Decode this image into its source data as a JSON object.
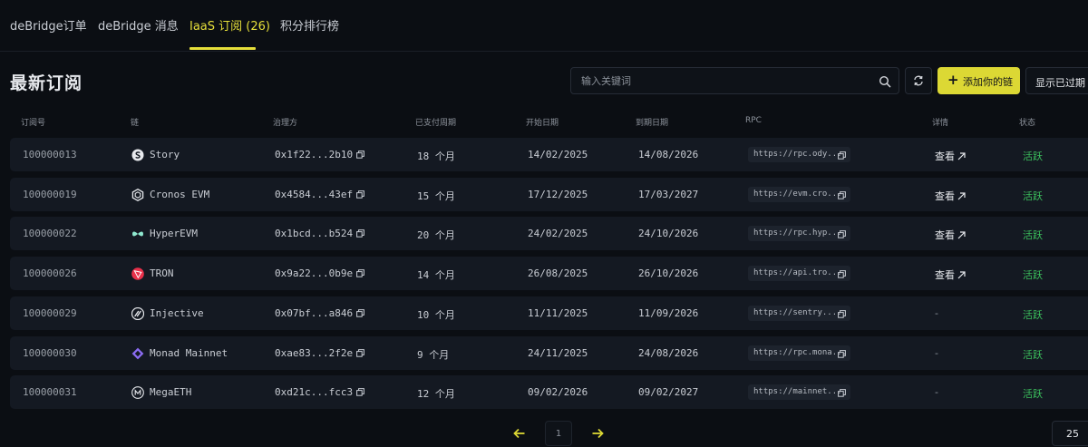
{
  "tabs": [
    {
      "label": "deBridge订单"
    },
    {
      "label": "deBridge 消息"
    },
    {
      "label": "IaaS 订阅 (26)"
    },
    {
      "label": "积分排行榜"
    }
  ],
  "page_title": "最新订阅",
  "search": {
    "placeholder": "输入关键词",
    "value": ""
  },
  "toolbar": {
    "add_label": "添加你的链",
    "expired_label": "显示已过期"
  },
  "columns": [
    "订阅号",
    "链",
    "治理方",
    "已支付周期",
    "开始日期",
    "到期日期",
    "RPC",
    "详情",
    "状态"
  ],
  "rows": [
    {
      "id": "100000013",
      "chain": "Story",
      "icon": "story-icon",
      "owner": "0x1f22...2b10",
      "period": "18 个月",
      "start": "14/02/2025",
      "end": "14/08/2026",
      "rpc": "https://rpc.ody...",
      "detail": "查看",
      "status": "活跃"
    },
    {
      "id": "100000019",
      "chain": "Cronos EVM",
      "icon": "cronos-icon",
      "owner": "0x4584...43ef",
      "period": "15 个月",
      "start": "17/12/2025",
      "end": "17/03/2027",
      "rpc": "https://evm.cro...",
      "detail": "查看",
      "status": "活跃"
    },
    {
      "id": "100000022",
      "chain": "HyperEVM",
      "icon": "hyperevm-icon",
      "owner": "0x1bcd...b524",
      "period": "20 个月",
      "start": "24/02/2025",
      "end": "24/10/2026",
      "rpc": "https://rpc.hyp...",
      "detail": "查看",
      "status": "活跃"
    },
    {
      "id": "100000026",
      "chain": "TRON",
      "icon": "tron-icon",
      "owner": "0x9a22...0b9e",
      "period": "14 个月",
      "start": "26/08/2025",
      "end": "26/10/2026",
      "rpc": "https://api.tro...",
      "detail": "查看",
      "status": "活跃"
    },
    {
      "id": "100000029",
      "chain": "Injective",
      "icon": "injective-icon",
      "owner": "0x07bf...a846",
      "period": "10 个月",
      "start": "11/11/2025",
      "end": "11/09/2026",
      "rpc": "https://sentry....",
      "detail": "-",
      "status": "活跃"
    },
    {
      "id": "100000030",
      "chain": "Monad Mainnet",
      "icon": "monad-icon",
      "owner": "0xae83...2f2e",
      "period": "9 个月",
      "start": "24/11/2025",
      "end": "24/08/2026",
      "rpc": "https://rpc.mona...",
      "detail": "-",
      "status": "活跃"
    },
    {
      "id": "100000031",
      "chain": "MegaETH",
      "icon": "megaeth-icon",
      "owner": "0xd21c...fcc3",
      "period": "12 个月",
      "start": "09/02/2026",
      "end": "09/02/2027",
      "rpc": "https://mainnet...",
      "detail": "-",
      "status": "活跃"
    }
  ],
  "pagination": {
    "current_page": "1",
    "page_size": "25"
  },
  "colors": {
    "accent": "#dcd834",
    "active_status": "#3bbf5c",
    "background": "#0b0e13",
    "row_background": "#141922"
  }
}
